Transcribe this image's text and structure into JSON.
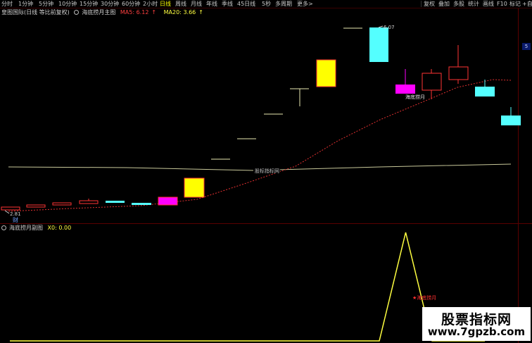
{
  "toolbar": {
    "periods": [
      "分时",
      "1分钟",
      "5分钟",
      "10分钟",
      "15分钟",
      "30分钟",
      "60分钟",
      "2小时",
      "日线",
      "周线",
      "月线",
      "年线",
      "季线",
      "45日线",
      "5秒",
      "多周期",
      "更多>"
    ],
    "active_period": "日线",
    "right_items": [
      "复权",
      "叠加",
      "多股",
      "统计",
      "画线",
      "F10",
      "标记",
      "+自选"
    ]
  },
  "main_chart": {
    "stock_title": "皇图国际(日线 等比前复权)",
    "indicator_name": "海底捞月主图",
    "ma5_label": "MA5: 6.12",
    "ma5_arrow": "↑",
    "ma20_label": "MA20: 3.66",
    "ma20_arrow": "↑",
    "high_label": "6.07",
    "low_label": "2.81",
    "signal_label": "海底捞月",
    "watermark_label": "股标指标网",
    "event_marker": "财",
    "right_price_tick": "5",
    "colors": {
      "bull_outline": "#ff3333",
      "bull_fill_strong": "#ffff00",
      "bull_fill_signal": "#ff00ff",
      "bear_fill": "#54ffff",
      "ma_dotted": "#e03030",
      "long_line": "#c8c89a",
      "flat_tick": "#e8e8b0"
    }
  },
  "sub_chart": {
    "indicator_name": "海底捞月副图",
    "x0_label": "X0: 0.00",
    "signal_label": "海底捞月",
    "line_color": "#ffff40",
    "values": [
      0,
      0,
      0,
      0,
      0,
      0,
      0,
      0,
      0,
      0,
      0,
      0,
      0,
      0,
      0,
      1,
      0,
      0,
      0
    ]
  },
  "watermark": {
    "title": "股票指标网",
    "url": "www.7gpzb.com"
  }
}
